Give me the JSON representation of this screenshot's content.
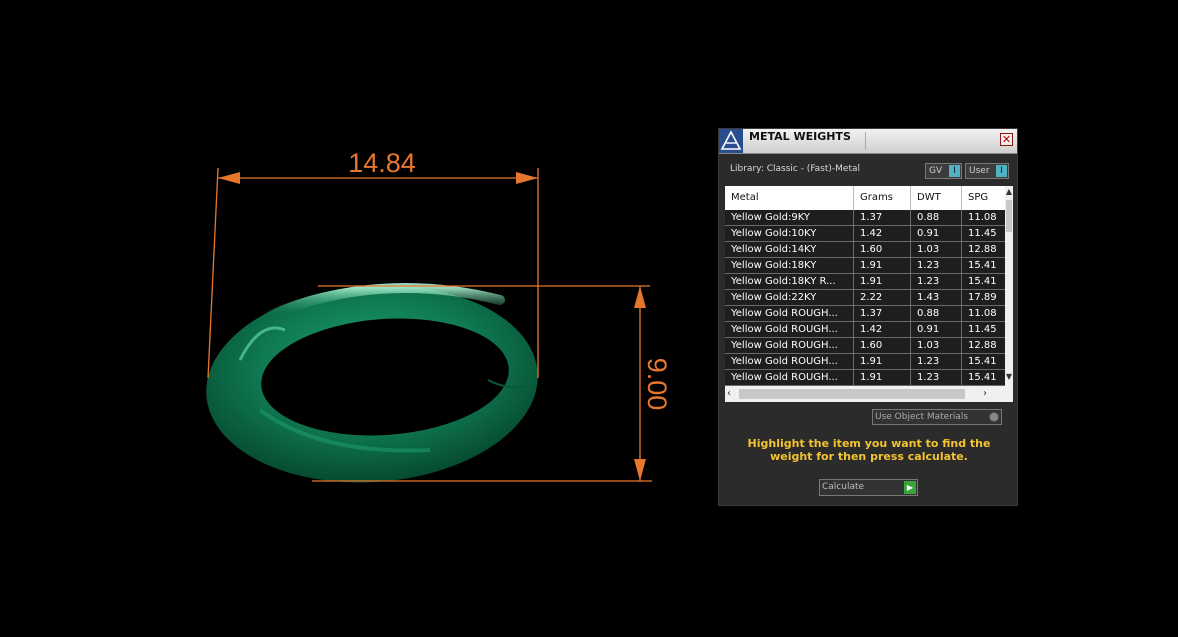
{
  "viewport": {
    "width_dimension": "14.84",
    "height_dimension": "9.00",
    "colors": {
      "dimension": "#e8772e",
      "ring": "#0f7a52",
      "background": "#000000"
    }
  },
  "panel": {
    "title": "METAL WEIGHTS",
    "close_icon": "close-icon",
    "library_label": "Library: Classic - (Fast)-Metal",
    "gv_label": "GV",
    "user_label": "User",
    "toggle_symbol": "I",
    "columns": [
      "Metal",
      "Grams",
      "DWT",
      "SPG"
    ],
    "rows": [
      [
        "Yellow Gold:9KY",
        "1.37",
        "0.88",
        "11.08"
      ],
      [
        "Yellow Gold:10KY",
        "1.42",
        "0.91",
        "11.45"
      ],
      [
        "Yellow Gold:14KY",
        "1.60",
        "1.03",
        "12.88"
      ],
      [
        "Yellow Gold:18KY",
        "1.91",
        "1.23",
        "15.41"
      ],
      [
        "Yellow Gold:18KY R...",
        "1.91",
        "1.23",
        "15.41"
      ],
      [
        "Yellow Gold:22KY",
        "2.22",
        "1.43",
        "17.89"
      ],
      [
        "Yellow Gold ROUGH...",
        "1.37",
        "0.88",
        "11.08"
      ],
      [
        "Yellow Gold ROUGH...",
        "1.42",
        "0.91",
        "11.45"
      ],
      [
        "Yellow Gold ROUGH...",
        "1.60",
        "1.03",
        "12.88"
      ],
      [
        "Yellow Gold ROUGH...",
        "1.91",
        "1.23",
        "15.41"
      ],
      [
        "Yellow Gold ROUGH...",
        "1.91",
        "1.23",
        "15.41"
      ]
    ],
    "use_object_materials_label": "Use Object Materials",
    "hint_text": "Highlight the item you want to find the weight for then press calculate.",
    "calculate_label": "Calculate",
    "accent_color": "#f3c430"
  }
}
